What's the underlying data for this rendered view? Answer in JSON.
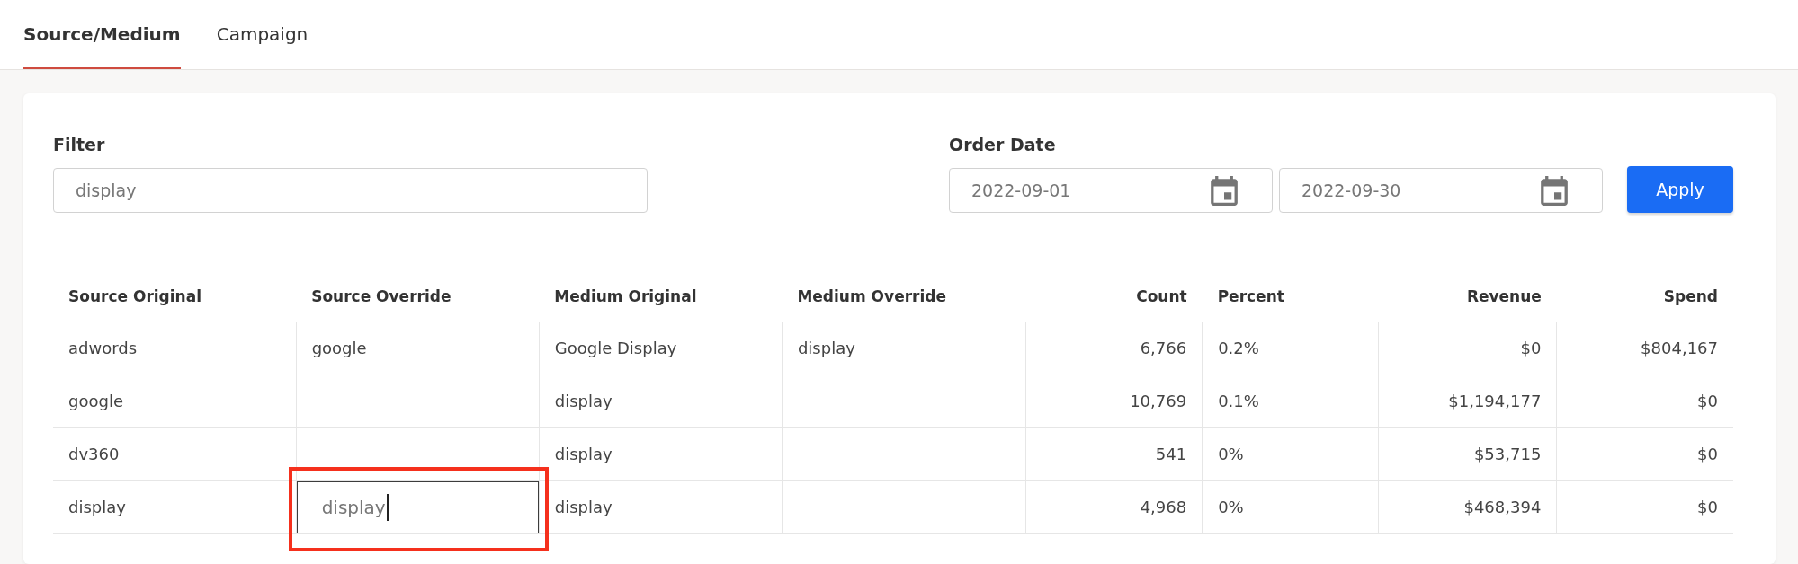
{
  "tabs": [
    {
      "label": "Source/Medium",
      "selected": true
    },
    {
      "label": "Campaign",
      "selected": false
    }
  ],
  "filter": {
    "label": "Filter",
    "value": "display"
  },
  "order_date": {
    "label": "Order Date",
    "fields": [
      {
        "value": "2022-09-01"
      },
      {
        "value": "2022-09-30"
      }
    ]
  },
  "apply_button": {
    "label": "Apply"
  },
  "table": {
    "columns": [
      {
        "label": "Source Original",
        "kind": "text"
      },
      {
        "label": "Source Override",
        "kind": "text"
      },
      {
        "label": "Medium Original",
        "kind": "text"
      },
      {
        "label": "Medium Override",
        "kind": "text"
      },
      {
        "label": "Count",
        "kind": "count"
      },
      {
        "label": "Percent",
        "kind": "percent"
      },
      {
        "label": "Revenue",
        "kind": "currency"
      },
      {
        "label": "Spend",
        "kind": "currency"
      }
    ],
    "rows": [
      {
        "cells": [
          {
            "kind": "text",
            "text": "adwords"
          },
          {
            "kind": "text",
            "text": "google"
          },
          {
            "kind": "text",
            "text": "Google Display"
          },
          {
            "kind": "text",
            "text": "display"
          },
          {
            "kind": "text",
            "text": "6,766"
          },
          {
            "kind": "text",
            "text": "0.2%"
          },
          {
            "kind": "text",
            "text": "$0"
          },
          {
            "kind": "text",
            "text": "$804,167"
          }
        ]
      },
      {
        "cells": [
          {
            "kind": "text",
            "text": "google"
          },
          {
            "kind": "text"
          },
          {
            "kind": "text",
            "text": "display"
          },
          {
            "kind": "text"
          },
          {
            "kind": "text",
            "text": "10,769"
          },
          {
            "kind": "text",
            "text": "0.1%"
          },
          {
            "kind": "text",
            "text": "$1,194,177"
          },
          {
            "kind": "text",
            "text": "$0"
          }
        ]
      },
      {
        "cells": [
          {
            "kind": "text",
            "text": "dv360"
          },
          {
            "kind": "text"
          },
          {
            "kind": "text",
            "text": "display"
          },
          {
            "kind": "text"
          },
          {
            "kind": "text",
            "text": "541"
          },
          {
            "kind": "text",
            "text": "0%"
          },
          {
            "kind": "text",
            "text": "$53,715"
          },
          {
            "kind": "text",
            "text": "$0"
          }
        ]
      },
      {
        "cells": [
          {
            "kind": "text",
            "text": "display"
          },
          {
            "kind": "input",
            "value": "display",
            "focused": true,
            "highlighted": true
          },
          {
            "kind": "text",
            "text": "display"
          },
          {
            "kind": "text"
          },
          {
            "kind": "text",
            "text": "4,968"
          },
          {
            "kind": "text",
            "text": "0%"
          },
          {
            "kind": "text",
            "text": "$468,394"
          },
          {
            "kind": "text",
            "text": "$0"
          }
        ]
      }
    ]
  }
}
